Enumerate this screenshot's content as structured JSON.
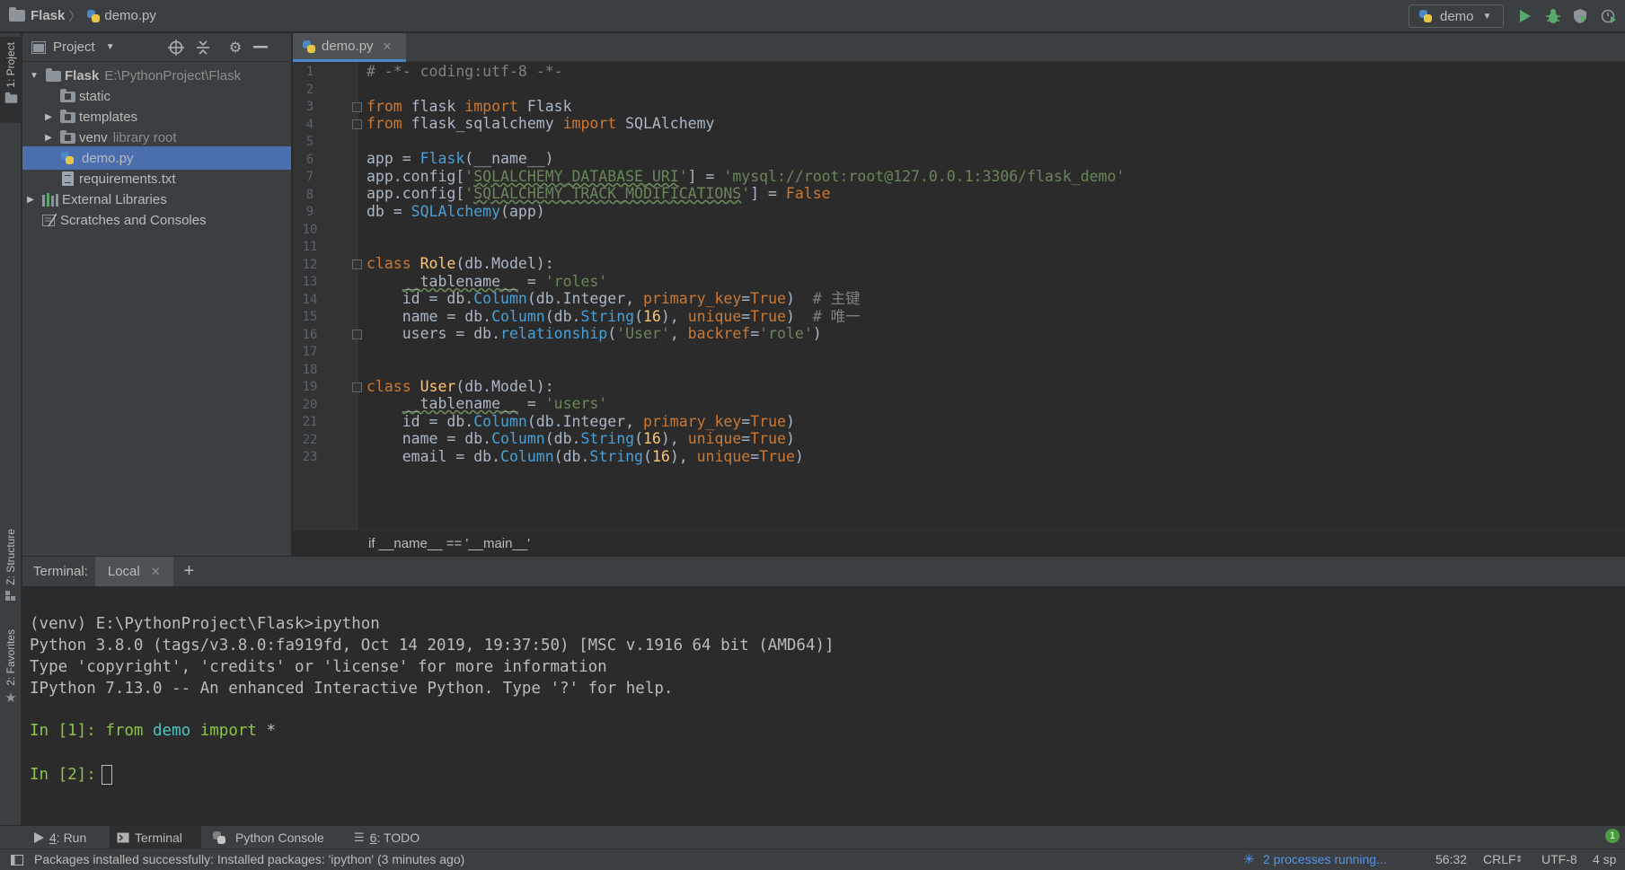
{
  "breadcrumbs": {
    "project": "Flask",
    "file": "demo.py"
  },
  "run_config": {
    "name": "demo"
  },
  "left_strip": {
    "project_tab": "1: Project",
    "structure_tab": "Z: Structure",
    "favorites_tab": "2: Favorites"
  },
  "project_panel": {
    "title": "Project",
    "tree": [
      {
        "name": "Flask",
        "extra": "E:\\PythonProject\\Flask"
      },
      {
        "name": "static",
        "extra": ""
      },
      {
        "name": "templates",
        "extra": ""
      },
      {
        "name": "venv",
        "extra": "library root"
      },
      {
        "name": "demo.py",
        "extra": ""
      },
      {
        "name": "requirements.txt",
        "extra": ""
      },
      {
        "name": "External Libraries",
        "extra": ""
      },
      {
        "name": "Scratches and Consoles",
        "extra": ""
      }
    ]
  },
  "editor": {
    "tab_label": "demo.py",
    "line_numbers": [
      "1",
      "2",
      "3",
      "4",
      "5",
      "6",
      "7",
      "8",
      "9",
      "10",
      "11",
      "12",
      "13",
      "14",
      "15",
      "16",
      "17",
      "18",
      "19",
      "20",
      "21",
      "22",
      "23"
    ],
    "breadcrumb": "if __name__ == '__main__'"
  },
  "terminal": {
    "title": "Terminal:",
    "tab": "Local",
    "lines": [
      "(venv) E:\\PythonProject\\Flask>ipython",
      "Python 3.8.0 (tags/v3.8.0:fa919fd, Oct 14 2019, 19:37:50) [MSC v.1916 64 bit (AMD64)]",
      "Type 'copyright', 'credits' or 'license' for more information",
      "IPython 7.13.0 -- An enhanced Interactive Python. Type '?' for help."
    ],
    "prompt1": "In [1]:",
    "cmd1_kw1": "from",
    "cmd1_mod": "demo",
    "cmd1_kw2": "import",
    "cmd1_rest": "*",
    "prompt2": "In [2]:"
  },
  "bottom_tabs": {
    "run_num": "4",
    "run": ": Run",
    "terminal": "Terminal",
    "python_console": "Python Console",
    "todo_num": "6",
    "todo": ": TODO"
  },
  "status": {
    "message": "Packages installed successfully: Installed packages: 'ipython' (3 minutes ago)",
    "processes": "2 processes running...",
    "position": "56:32",
    "line_sep": "CRLF",
    "encoding": "UTF-8",
    "indent": "4 sp",
    "notifications": "1"
  },
  "colors": {
    "selection": "#4b6eaf",
    "keyword": "#cc7832",
    "string": "#6a8759",
    "run_green": "#59a869",
    "link_blue": "#5394ec"
  },
  "code_tokens": {
    "l1": "# -*- coding:utf-8 -*-",
    "from": "from",
    "import": "import",
    "class": "class",
    "flask_mod": "flask",
    "Flask": "Flask",
    "flask_sqlalchemy": "flask_sqlalchemy",
    "SQLAlchemy": "SQLAlchemy",
    "app_eq": "app = ",
    "name_arg": "(__name__)",
    "app_config_open": "app.config[",
    "uri_key_q": "'",
    "uri_key": "SQLALCHEMY_DATABASE_URI",
    "close_eq": "'] = ",
    "uri_val": "'mysql://root:root@127.0.0.1:3306/flask_demo'",
    "track_key": "SQLALCHEMY_TRACK_MODIFICATIONS",
    "False": "False",
    "db_eq": "db = ",
    "app_arg": "(app)",
    "Role": "Role",
    "User": "User",
    "model_base": "(db.Model):",
    "indent": "    ",
    "tablename": "__tablename__",
    "eq": " = ",
    "roles": "'roles'",
    "users_str": "'users'",
    "id_eq": "id = db.",
    "Column": "Column",
    "integer_arg": "(db.Integer, ",
    "primary_key": "primary_key",
    "True": "True",
    "eq_only": "=",
    "close_paren": ")",
    "cmt_pk": "  # 主键",
    "name_eq": "name = db.",
    "string_open": "(db.",
    "String": "String",
    "n16": "16",
    "str_close": "(",
    "str_close2": "), ",
    "unique": "unique",
    "cmt_unique": "  # 唯一",
    "users_eq": "users = db.",
    "relationship": "relationship",
    "rel_args_open": "(",
    "user_str": "'User'",
    "comma": ", ",
    "backref": "backref",
    "role_str": "'role'",
    "email_eq": "email = db."
  }
}
